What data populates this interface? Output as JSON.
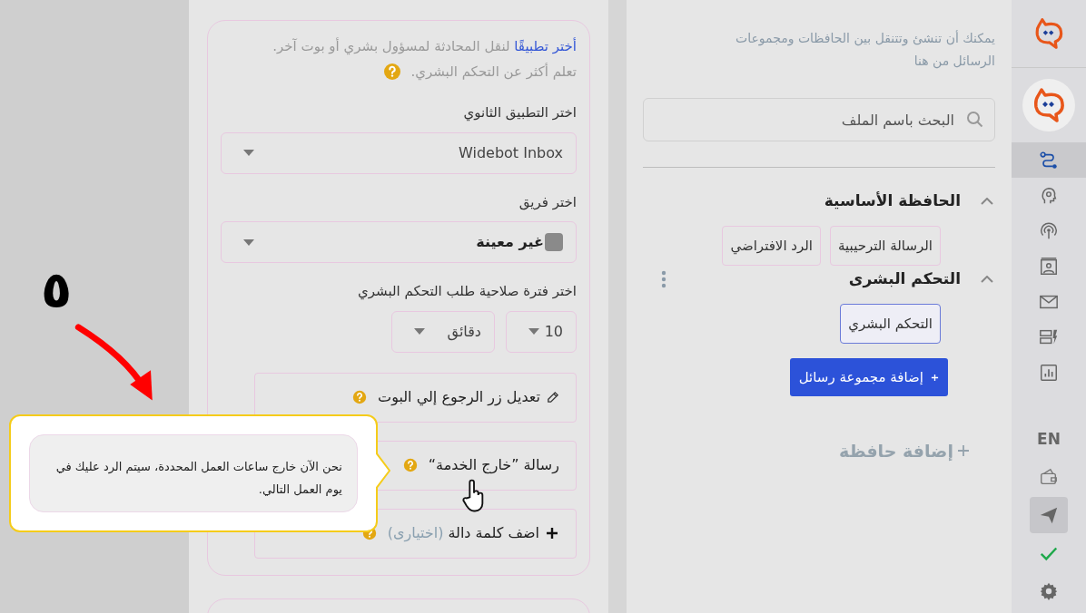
{
  "annotation": {
    "step_number": "٥"
  },
  "tooltip": {
    "text": "نحن الآن خارج ساعات العمل المحددة، سيتم الرد عليك في يوم العمل التالي."
  },
  "config_panel": {
    "intro_link": "أختر تطبيقًا",
    "intro_text": "لنقل المحادثة لمسؤول بشري أو بوت آخر.",
    "learn_more": "تعلم أكثر عن التحكم البشري.",
    "app_label": "اختر التطبيق الثانوي",
    "app_value": "Widebot Inbox",
    "team_label": "اختر فريق",
    "team_value": "غير معينة",
    "validity_label": "اختر فترة صلاحية طلب التحكم البشري",
    "validity_number": "10",
    "validity_unit": "دقائق",
    "rows": [
      {
        "kind": "edit",
        "label": "تعديل زر الرجوع إلي البوت"
      },
      {
        "kind": "message",
        "label": "رسالة ”خارج الخدمة“"
      },
      {
        "kind": "add",
        "label": "اضف كلمة دالة",
        "optional": "(اختيارى)"
      }
    ]
  },
  "flow_panel": {
    "description": "يمكنك أن تنشئ وتتنقل بين الحافظات ومجموعات الرسائل من هنا",
    "search_placeholder": "البحث باسم الملف",
    "folders": [
      {
        "title": "الحافظة الأساسية",
        "expanded": true,
        "has_menu": false,
        "items": [
          {
            "label": "الرسالة الترحيبية",
            "selected": false
          },
          {
            "label": "الرد الافتراضي",
            "selected": false
          }
        ]
      },
      {
        "title": "التحكم البشرى",
        "expanded": true,
        "has_menu": true,
        "items": [
          {
            "label": "التحكم البشري",
            "selected": true
          }
        ],
        "add_group_button": "إضافة مجموعة رسائل"
      }
    ],
    "add_folder": "إضافة حافظة"
  },
  "nav": {
    "items": [
      {
        "selected": true
      },
      {
        "selected": false
      },
      {
        "selected": false
      },
      {
        "selected": false
      },
      {
        "selected": false
      },
      {
        "selected": false
      },
      {
        "selected": false
      }
    ],
    "language": "EN",
    "bottom_items": [
      {
        "selected": false
      },
      {
        "selected": true
      },
      {
        "selected": false
      },
      {
        "selected": false
      }
    ]
  }
}
